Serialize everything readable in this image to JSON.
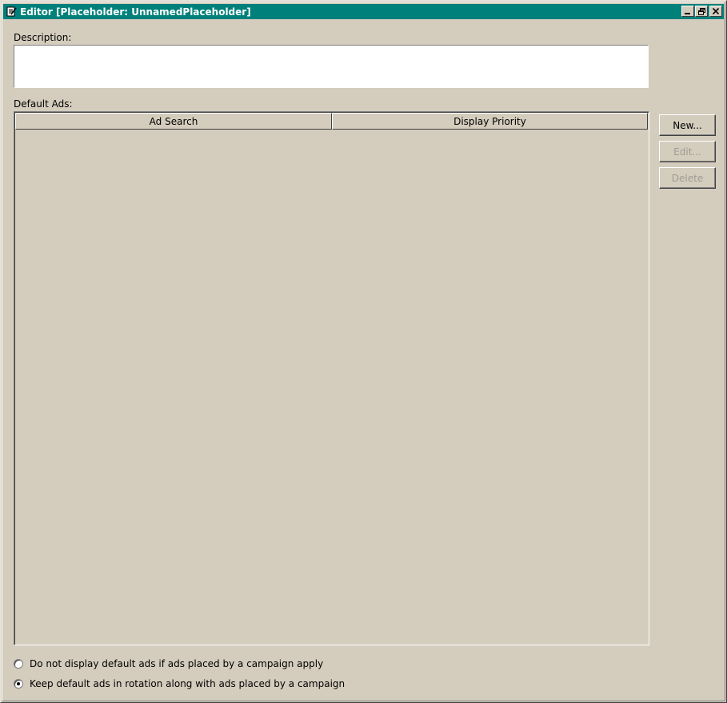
{
  "window": {
    "title": "Editor [Placeholder: UnnamedPlaceholder]",
    "icon": "edit-document-icon",
    "controls": [
      "minimize-icon",
      "restore-icon",
      "close-icon"
    ]
  },
  "description": {
    "label": "Description:",
    "value": ""
  },
  "default_ads": {
    "label": "Default Ads:",
    "columns": [
      "Ad Search",
      "Display Priority"
    ],
    "rows": []
  },
  "buttons": {
    "new": "New...",
    "edit": "Edit...",
    "delete": "Delete"
  },
  "rotation_options": {
    "options": [
      {
        "label": "Do not display default ads if ads placed by a campaign apply",
        "selected": false
      },
      {
        "label": "Keep default ads in rotation along with ads placed by a campaign",
        "selected": true
      }
    ]
  },
  "colors": {
    "titlebar": "#00807a",
    "background": "#d4ccbd"
  }
}
